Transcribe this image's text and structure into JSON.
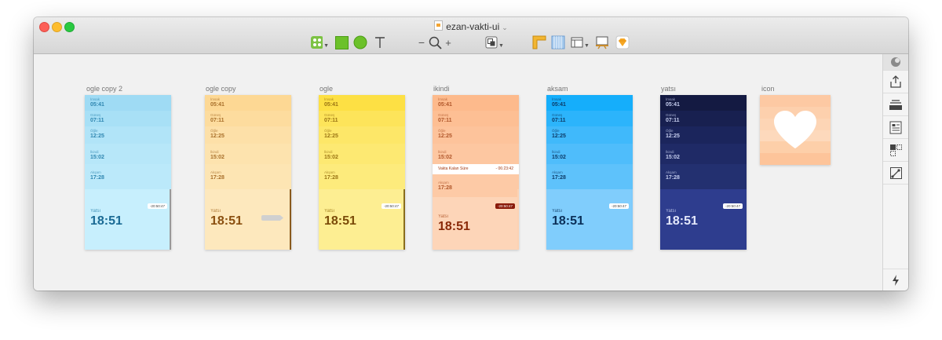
{
  "window": {
    "title": "ezan-vakti-ui"
  },
  "toolbar": {
    "zoom_minus": "−",
    "zoom_plus": "+"
  },
  "icons": {
    "toolbar": [
      "insert-shapes-icon",
      "rectangle-icon",
      "oval-icon",
      "text-icon",
      "zoom-out-icon",
      "zoom-icon",
      "zoom-in-icon",
      "boolean-ops-icon",
      "ruler-icon",
      "grid-icon",
      "layout-icon",
      "preview-icon",
      "sketch-logo-icon"
    ],
    "panel": [
      "cloud-icon",
      "export-icon",
      "layer-stack-icon",
      "document-icon",
      "symbols-icon",
      "edit-path-icon",
      "lightning-icon"
    ]
  },
  "artboards": [
    {
      "name": "ogle copy 2",
      "bg": "#bdeafb",
      "edge": "#999",
      "rows": [
        {
          "name": "İmsak",
          "time": "05:41",
          "color": "#9fdbf4"
        },
        {
          "name": "Güneş",
          "time": "07:11",
          "color": "#a8e0f6"
        },
        {
          "name": "Öğle",
          "time": "12:25",
          "color": "#b1e4f8"
        },
        {
          "name": "İkindi",
          "time": "15:02",
          "color": "#b7e7f9"
        },
        {
          "name": "Akşam",
          "time": "17:28",
          "color": "#bbe9fa"
        }
      ],
      "big": {
        "name": "Yatsı",
        "time": "18:51",
        "color": "#c7effd"
      },
      "countdown": "-20:50:47",
      "text_color": "#2f86b0",
      "big_color": "#1a6a94",
      "pill_bg": "#ffffff",
      "pill_fg": "#444"
    },
    {
      "name": "ogle copy",
      "bg": "#fde6b6",
      "edge": "#8a5a1c",
      "rows": [
        {
          "name": "İmsak",
          "time": "05:41",
          "color": "#fdd894"
        },
        {
          "name": "Güneş",
          "time": "07:11",
          "color": "#fddc9e"
        },
        {
          "name": "Öğle",
          "time": "12:25",
          "color": "#fde0a8"
        },
        {
          "name": "İkindi",
          "time": "15:02",
          "color": "#fde3ae"
        },
        {
          "name": "Akşam",
          "time": "17:28",
          "color": "#fde5b3"
        }
      ],
      "big": {
        "name": "Yatsı",
        "time": "18:51",
        "color": "#fde8bd"
      },
      "countdown": "",
      "text_color": "#a86f2a",
      "big_color": "#8a4f10",
      "pill_bg": "#d0d0d0",
      "pill_fg": "#d0d0d0"
    },
    {
      "name": "ogle",
      "bg": "#fdec8e",
      "edge": "#8a6d1c",
      "rows": [
        {
          "name": "İmsak",
          "time": "05:41",
          "color": "#fde044"
        },
        {
          "name": "Güneş",
          "time": "07:11",
          "color": "#fde45a"
        },
        {
          "name": "Öğle",
          "time": "12:25",
          "color": "#fde768"
        },
        {
          "name": "İkindi",
          "time": "15:02",
          "color": "#fde972"
        },
        {
          "name": "Akşam",
          "time": "17:28",
          "color": "#fdeb7c"
        }
      ],
      "big": {
        "name": "Yatsı",
        "time": "18:51",
        "color": "#fdee92"
      },
      "countdown": "-20:50:47",
      "text_color": "#9a7414",
      "big_color": "#7a4a08",
      "pill_bg": "#ffffff",
      "pill_fg": "#444"
    },
    {
      "name": "ikindi",
      "bg": "#fdd3b4",
      "edge": "#fdd3b4",
      "rows": [
        {
          "name": "İmsak",
          "time": "05:41",
          "color": "#fdba8c"
        },
        {
          "name": "Güneş",
          "time": "07:11",
          "color": "#fdbf94"
        },
        {
          "name": "Öğle",
          "time": "12:25",
          "color": "#fdc39b"
        },
        {
          "name": "İkindi",
          "time": "15:02",
          "color": "#fdc7a1"
        },
        {
          "name": "Akşam",
          "time": "17:28",
          "color": "#fdcaa6"
        }
      ],
      "big": {
        "name": "Yatsı",
        "time": "18:51",
        "color": "#fdd5b8"
      },
      "countdown": "-20:50:47",
      "remaining": {
        "label": "Vakta Kalan Süre",
        "value": "- 06:23:42"
      },
      "text_color": "#b0562a",
      "big_color": "#8a2a08",
      "pill_bg": "#8a1a0a",
      "pill_fg": "#ffffff"
    },
    {
      "name": "aksam",
      "bg": "#7ecbfc",
      "edge": "#7ecbfc",
      "rows": [
        {
          "name": "İmsak",
          "time": "05:41",
          "color": "#15aefb"
        },
        {
          "name": "Güneş",
          "time": "07:11",
          "color": "#2cb4fb"
        },
        {
          "name": "Öğle",
          "time": "12:25",
          "color": "#40b9fb"
        },
        {
          "name": "İkindi",
          "time": "15:02",
          "color": "#4fbdfb"
        },
        {
          "name": "Akşam",
          "time": "17:28",
          "color": "#5ec2fb"
        }
      ],
      "big": {
        "name": "Yatsı",
        "time": "18:51",
        "color": "#80cdfc"
      },
      "countdown": "-20:50:47",
      "text_color": "#0d3a66",
      "big_color": "#0a2f58",
      "pill_bg": "#ffffff",
      "pill_fg": "#444"
    },
    {
      "name": "yatsı",
      "bg": "#2e3d8e",
      "edge": "#2e3d8e",
      "rows": [
        {
          "name": "İmsak",
          "time": "05:41",
          "color": "#141a42"
        },
        {
          "name": "Güneş",
          "time": "07:11",
          "color": "#182050"
        },
        {
          "name": "Öğle",
          "time": "12:25",
          "color": "#1b255c"
        },
        {
          "name": "İkindi",
          "time": "15:02",
          "color": "#1f2a66"
        },
        {
          "name": "Akşam",
          "time": "17:28",
          "color": "#233070"
        }
      ],
      "big": {
        "name": "Yatsı",
        "time": "18:51",
        "color": "#2e3d8e"
      },
      "countdown": "-20:50:47",
      "text_color": "#c6ceef",
      "big_color": "#e4e8fb",
      "pill_bg": "#ffffff",
      "pill_fg": "#444"
    }
  ],
  "icon_artboard": {
    "name": "icon",
    "stripes": [
      "#fdc9a3",
      "#fdd0ad",
      "#fdd5b5",
      "#fdd9bc",
      "#fdcfa9",
      "#fdc49a"
    ],
    "heart_color": "#ffffff"
  }
}
